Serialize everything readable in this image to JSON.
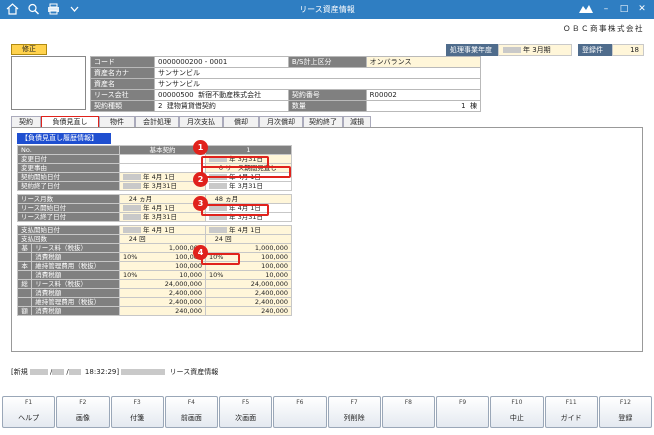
{
  "window": {
    "title": "リース資産情報"
  },
  "company": "ＯＢＣ商事株式会社",
  "status_badge": "修正",
  "fiscal": {
    "label": "処理事業年度",
    "value": "年 3月期"
  },
  "reg_count": {
    "label": "登録件数",
    "value": "18"
  },
  "info": {
    "code_label": "コード",
    "code_value": "0000000200 - 0001",
    "bs_label": "B/S計上区分",
    "bs_value": "オンバランス",
    "kana_label": "資産名カナ",
    "kana_value": "サンサンビル",
    "name_label": "資産名",
    "name_value": "サンサンビル",
    "lessor_label": "リース会社",
    "lessor_code": "00000500",
    "lessor_name": "新宿不動産株式会社",
    "contract_no_label": "契約番号",
    "contract_no_value": "R00002",
    "type_label": "契約種類",
    "type_code": "2",
    "type_name": "建物賃貸借契約",
    "qty_label": "数量",
    "qty_value": "1",
    "qty_unit": "棟"
  },
  "tabs": [
    "契約",
    "負債見直し",
    "物件",
    "会計処理",
    "月次支払",
    "償却",
    "月次償却",
    "契約終了",
    "減損"
  ],
  "section_title": "【負債見直し履歴情報】",
  "grid": {
    "head": {
      "no": "No.",
      "col1": "基本契約",
      "col2": "1"
    },
    "change_date": {
      "label": "変更日付",
      "col2": "年 3月31日"
    },
    "change_reason": {
      "label": "変更事由",
      "code": "0",
      "text": "リース期間見直し"
    },
    "contract_start": {
      "label": "契約開始日付",
      "col1": "年 4月 1日",
      "col2": "年 4月 1日"
    },
    "contract_end": {
      "label": "契約終了日付",
      "col1": "年 3月31日",
      "col2": "年 3月31日"
    },
    "lease_months": {
      "label": "リース月数",
      "col1": "24",
      "col2": "48",
      "unit": "ヵ月"
    },
    "lease_start": {
      "label": "リース開始日付",
      "col1": "年 4月 1日",
      "col2": "年 4月 1日"
    },
    "lease_end": {
      "label": "リース終了日付",
      "col1": "年 3月31日",
      "col2": "年 3月31日"
    },
    "pay_start": {
      "label": "支払開始日付",
      "col1": "年 4月 1日",
      "col2": "年 4月 1日"
    },
    "pay_count": {
      "label": "支払回数",
      "col1": "24",
      "col2": "24",
      "unit": "回"
    },
    "side_basic": [
      "基",
      "本"
    ],
    "side_total": [
      "総",
      "額"
    ],
    "basic_rows": [
      {
        "label": "リース料（税抜）",
        "rate1": "",
        "val1": "1,000,000",
        "rate2": "",
        "val2": "1,000,000"
      },
      {
        "label": "消費税額",
        "rate1": "10%",
        "val1": "100,000",
        "rate2": "10%",
        "val2": "100,000"
      },
      {
        "label": "維持管理費用（税抜）",
        "rate1": "",
        "val1": "100,000",
        "rate2": "",
        "val2": "100,000"
      },
      {
        "label": "消費税額",
        "rate1": "10%",
        "val1": "10,000",
        "rate2": "10%",
        "val2": "10,000"
      }
    ],
    "total_rows": [
      {
        "label": "リース料（税抜）",
        "val1": "24,000,000",
        "val2": "24,000,000"
      },
      {
        "label": "消費税額",
        "val1": "2,400,000",
        "val2": "2,400,000"
      },
      {
        "label": "維持管理費用（税抜）",
        "val1": "2,400,000",
        "val2": "2,400,000"
      },
      {
        "label": "消費税額",
        "val1": "240,000",
        "val2": "240,000"
      }
    ]
  },
  "markers": [
    "1",
    "2",
    "3",
    "4"
  ],
  "statusbar": {
    "prefix": "[新規",
    "time": "18:32:29]",
    "suffix": "リース資産情報"
  },
  "fkeys": [
    {
      "key": "F1",
      "label": "ヘルプ"
    },
    {
      "key": "F2",
      "label": "画像"
    },
    {
      "key": "F3",
      "label": "付箋"
    },
    {
      "key": "F4",
      "label": "前画面"
    },
    {
      "key": "F5",
      "label": "次画面"
    },
    {
      "key": "F6",
      "label": ""
    },
    {
      "key": "F7",
      "label": "列削除"
    },
    {
      "key": "F8",
      "label": ""
    },
    {
      "key": "F9",
      "label": ""
    },
    {
      "key": "F10",
      "label": "中止"
    },
    {
      "key": "F11",
      "label": "ガイド"
    },
    {
      "key": "F12",
      "label": "登録"
    }
  ],
  "colors": {
    "titlebar": "#2f7ec2",
    "highlight": "#e0221c",
    "input_bg": "#fff6d9",
    "label_bg": "#808080",
    "section_bg": "#1f4fd0"
  },
  "icons": [
    "home-icon",
    "search-icon",
    "print-icon",
    "menu-icon",
    "logo-icon"
  ]
}
